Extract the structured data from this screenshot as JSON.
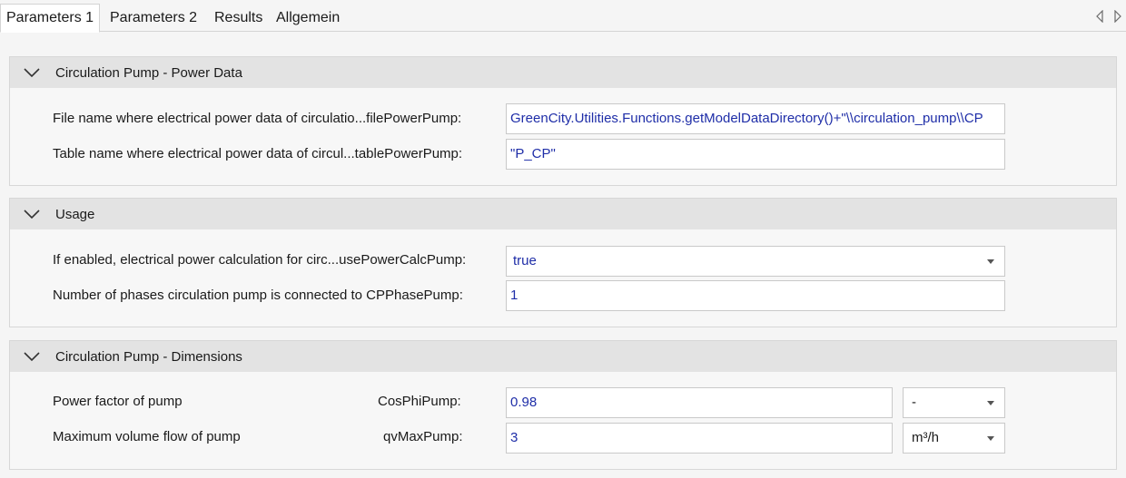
{
  "tabs": [
    {
      "label": "Parameters 1",
      "active": true
    },
    {
      "label": "Parameters 2",
      "active": false
    },
    {
      "label": "Results",
      "active": false
    },
    {
      "label": "Allgemein",
      "active": false
    }
  ],
  "icons": {
    "collapse": "chevron-down-icon",
    "scroll_left": "triangle-left-icon",
    "scroll_right": "triangle-right-icon",
    "dropdown": "dropdown-arrow-icon"
  },
  "colors": {
    "header_bg": "#e3e3e3",
    "value_text": "#1f2ea8",
    "panel_bg": "#f7f7f7"
  },
  "sections": {
    "power_data": {
      "title": "Circulation Pump - Power Data",
      "rows": [
        {
          "label": "File name where electrical power data of circulatio...filePowerPump:",
          "value": "GreenCity.Utilities.Functions.getModelDataDirectory()+\"\\\\circulation_pump\\\\CP"
        },
        {
          "label": "Table name where electrical power data of circul...tablePowerPump:",
          "value": "\"P_CP\""
        }
      ]
    },
    "usage": {
      "title": "Usage",
      "rows": [
        {
          "label": "If enabled, electrical power calculation for circ...usePowerCalcPump:",
          "value": "true"
        },
        {
          "label": "Number of phases circulation pump is connected to CPPhasePump:",
          "value": "1"
        }
      ]
    },
    "dimensions": {
      "title": "Circulation Pump - Dimensions",
      "rows": [
        {
          "label": "Power factor of pump",
          "param": "CosPhiPump:",
          "value": "0.98",
          "unit": "-"
        },
        {
          "label": "Maximum volume flow of pump",
          "param": "qvMaxPump:",
          "value": "3",
          "unit": "m³/h"
        }
      ]
    }
  }
}
